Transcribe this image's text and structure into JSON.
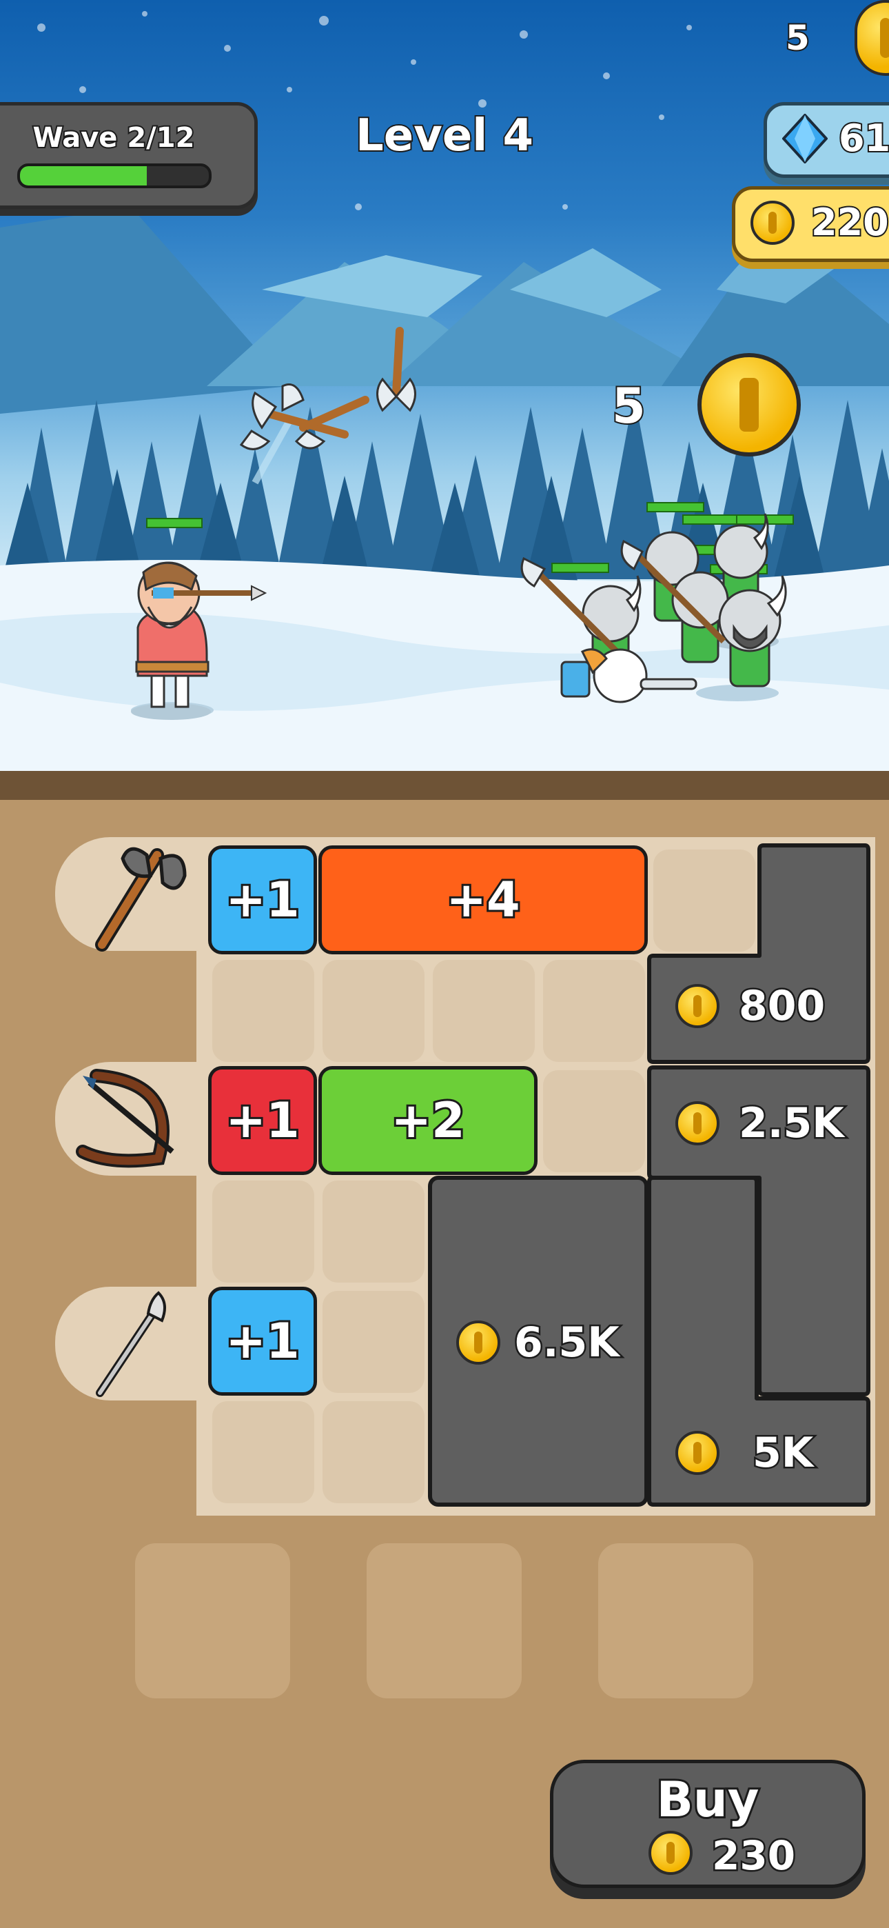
{
  "hud": {
    "wave_label": "Wave 2/12",
    "wave_progress": 0.67,
    "level_title": "Level 4",
    "top_coin_count": "5",
    "gems": "61",
    "gold": "220"
  },
  "battle": {
    "reward_float": "5",
    "hero_icon": "archer-hero",
    "enemy_icon": "viking-warrior"
  },
  "board": {
    "rows": [
      {
        "weapon_icon": "axe-icon",
        "blocks": [
          {
            "label": "+1",
            "color": "#3db5f5"
          },
          {
            "label": "+4",
            "color": "#ff6119"
          }
        ]
      },
      {
        "weapon_icon": "crossbow-icon",
        "blocks": [
          {
            "label": "+1",
            "color": "#e8303a"
          },
          {
            "label": "+2",
            "color": "#6ccf38"
          }
        ]
      },
      {
        "weapon_icon": "spear-icon",
        "blocks": [
          {
            "label": "+1",
            "color": "#3db5f5"
          }
        ]
      }
    ],
    "locked_prices": {
      "p800": "800",
      "p2_5k": "2.5K",
      "p6_5k": "6.5K",
      "p5k": "5K"
    }
  },
  "buy": {
    "label": "Buy",
    "price": "230"
  }
}
